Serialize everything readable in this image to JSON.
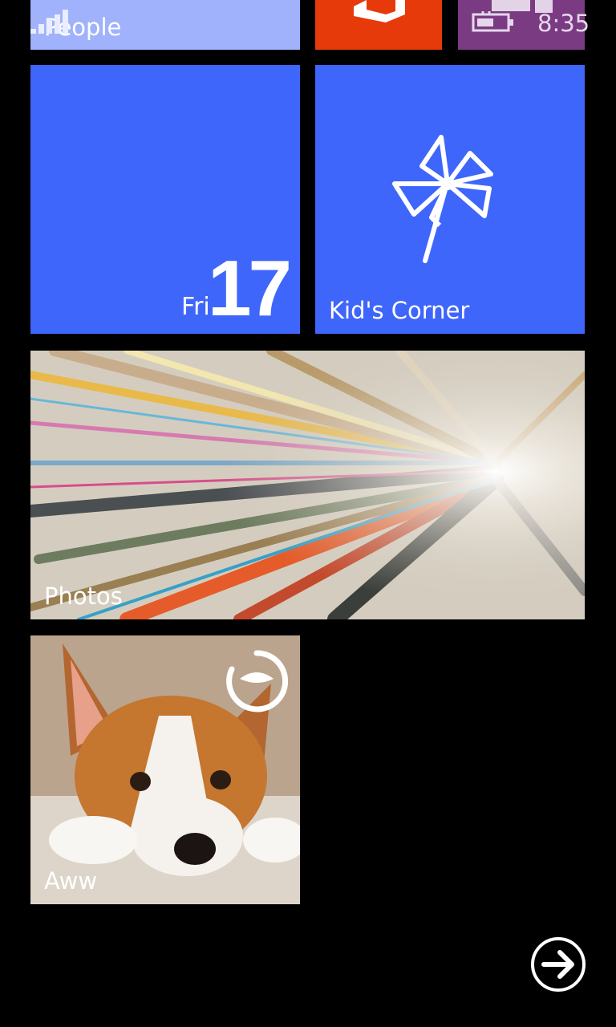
{
  "status_bar": {
    "time": "8:35",
    "icons": [
      "signal-icon",
      "battery-charging-icon"
    ]
  },
  "tiles": {
    "people": {
      "label": "People",
      "color": "#9fb2fb"
    },
    "office": {
      "icon": "office-icon",
      "color": "#e63a0a"
    },
    "purple": {
      "icon": "app-icon",
      "color": "#7a3b82"
    },
    "calendar": {
      "day": "Fri",
      "date": "17",
      "color": "#3f66fb"
    },
    "kids_corner": {
      "label": "Kid's Corner",
      "icon": "pinwheel-icon",
      "color": "#3f66fb"
    },
    "photos": {
      "label": "Photos",
      "image": "colorful-streamers-photo"
    },
    "aww": {
      "label": "Aww",
      "image": "corgi-puppy-photo",
      "icon": "reddit-alien-icon"
    }
  },
  "app_list_button": {
    "icon": "arrow-right-circle-icon"
  }
}
